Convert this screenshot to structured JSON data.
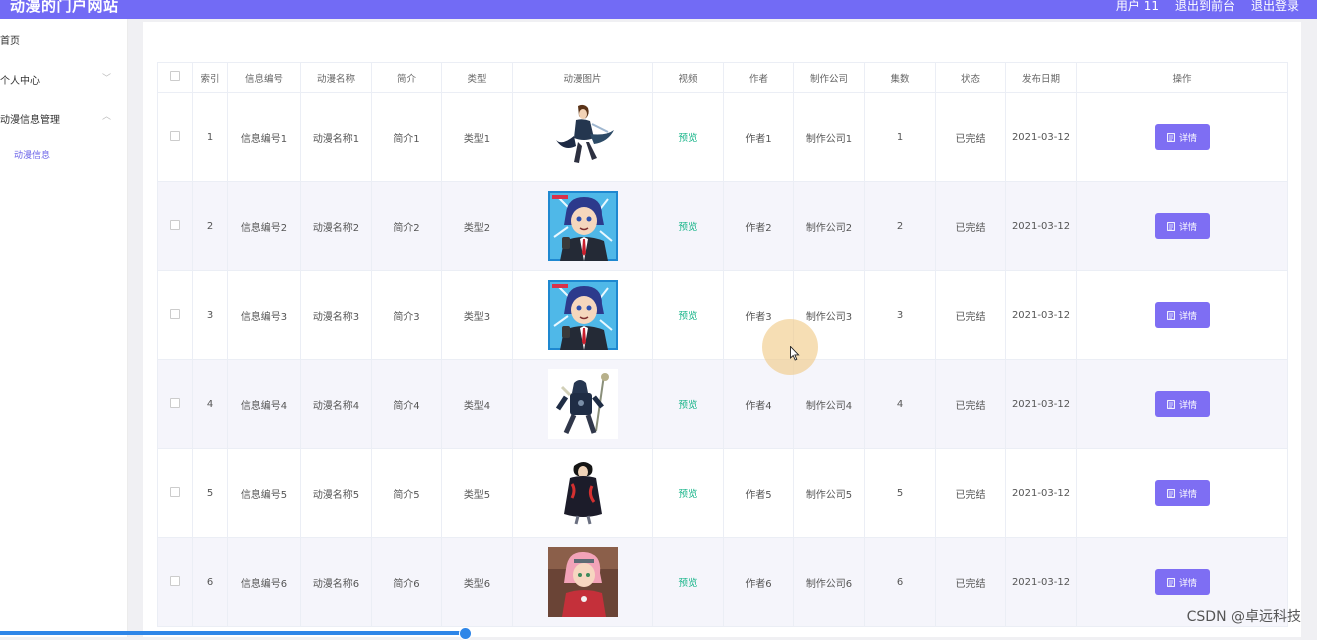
{
  "header": {
    "brand": "动漫的门户网站",
    "user": "用户 11",
    "to_front": "退出到前台",
    "logout": "退出登录",
    "bg_color": "#726bf5"
  },
  "sidebar": {
    "home": "首页",
    "personal": "个人中心",
    "info_mgmt": "动漫信息管理",
    "sub_info": "动漫信息",
    "arrow_down": "﹀",
    "arrow_up": "︿"
  },
  "table": {
    "headers": [
      "索引",
      "信息编号",
      "动漫名称",
      "简介",
      "类型",
      "动漫图片",
      "视频",
      "作者",
      "制作公司",
      "集数",
      "状态",
      "发布日期",
      "操作"
    ],
    "rows": [
      {
        "index": "1",
        "code": "信息编号1",
        "name": "动漫名称1",
        "intro": "简介1",
        "type": "类型1",
        "image": "anime-figure-1",
        "video": "预览",
        "author": "作者1",
        "company": "制作公司1",
        "episodes": "1",
        "status": "已完结",
        "date": "2021-03-12",
        "action": "详情"
      },
      {
        "index": "2",
        "code": "信息编号2",
        "name": "动漫名称2",
        "intro": "简介2",
        "type": "类型2",
        "image": "anime-figure-2",
        "video": "预览",
        "author": "作者2",
        "company": "制作公司2",
        "episodes": "2",
        "status": "已完结",
        "date": "2021-03-12",
        "action": "详情"
      },
      {
        "index": "3",
        "code": "信息编号3",
        "name": "动漫名称3",
        "intro": "简介3",
        "type": "类型3",
        "image": "anime-figure-3",
        "video": "预览",
        "author": "作者3",
        "company": "制作公司3",
        "episodes": "3",
        "status": "已完结",
        "date": "2021-03-12",
        "action": "详情"
      },
      {
        "index": "4",
        "code": "信息编号4",
        "name": "动漫名称4",
        "intro": "简介4",
        "type": "类型4",
        "image": "anime-figure-4",
        "video": "预览",
        "author": "作者4",
        "company": "制作公司4",
        "episodes": "4",
        "status": "已完结",
        "date": "2021-03-12",
        "action": "详情"
      },
      {
        "index": "5",
        "code": "信息编号5",
        "name": "动漫名称5",
        "intro": "简介5",
        "type": "类型5",
        "image": "anime-figure-5",
        "video": "预览",
        "author": "作者5",
        "company": "制作公司5",
        "episodes": "5",
        "status": "已完结",
        "date": "2021-03-12",
        "action": "详情"
      },
      {
        "index": "6",
        "code": "信息编号6",
        "name": "动漫名称6",
        "intro": "简介6",
        "type": "类型6",
        "image": "anime-figure-6",
        "video": "预览",
        "author": "作者6",
        "company": "制作公司6",
        "episodes": "6",
        "status": "已完结",
        "date": "2021-03-12",
        "action": "详情"
      }
    ]
  },
  "watermark": "CSDN @卓远科技",
  "colors": {
    "accent": "#7e6ef3",
    "video_link": "#19b58a",
    "stripe": "#f5f5fb"
  }
}
